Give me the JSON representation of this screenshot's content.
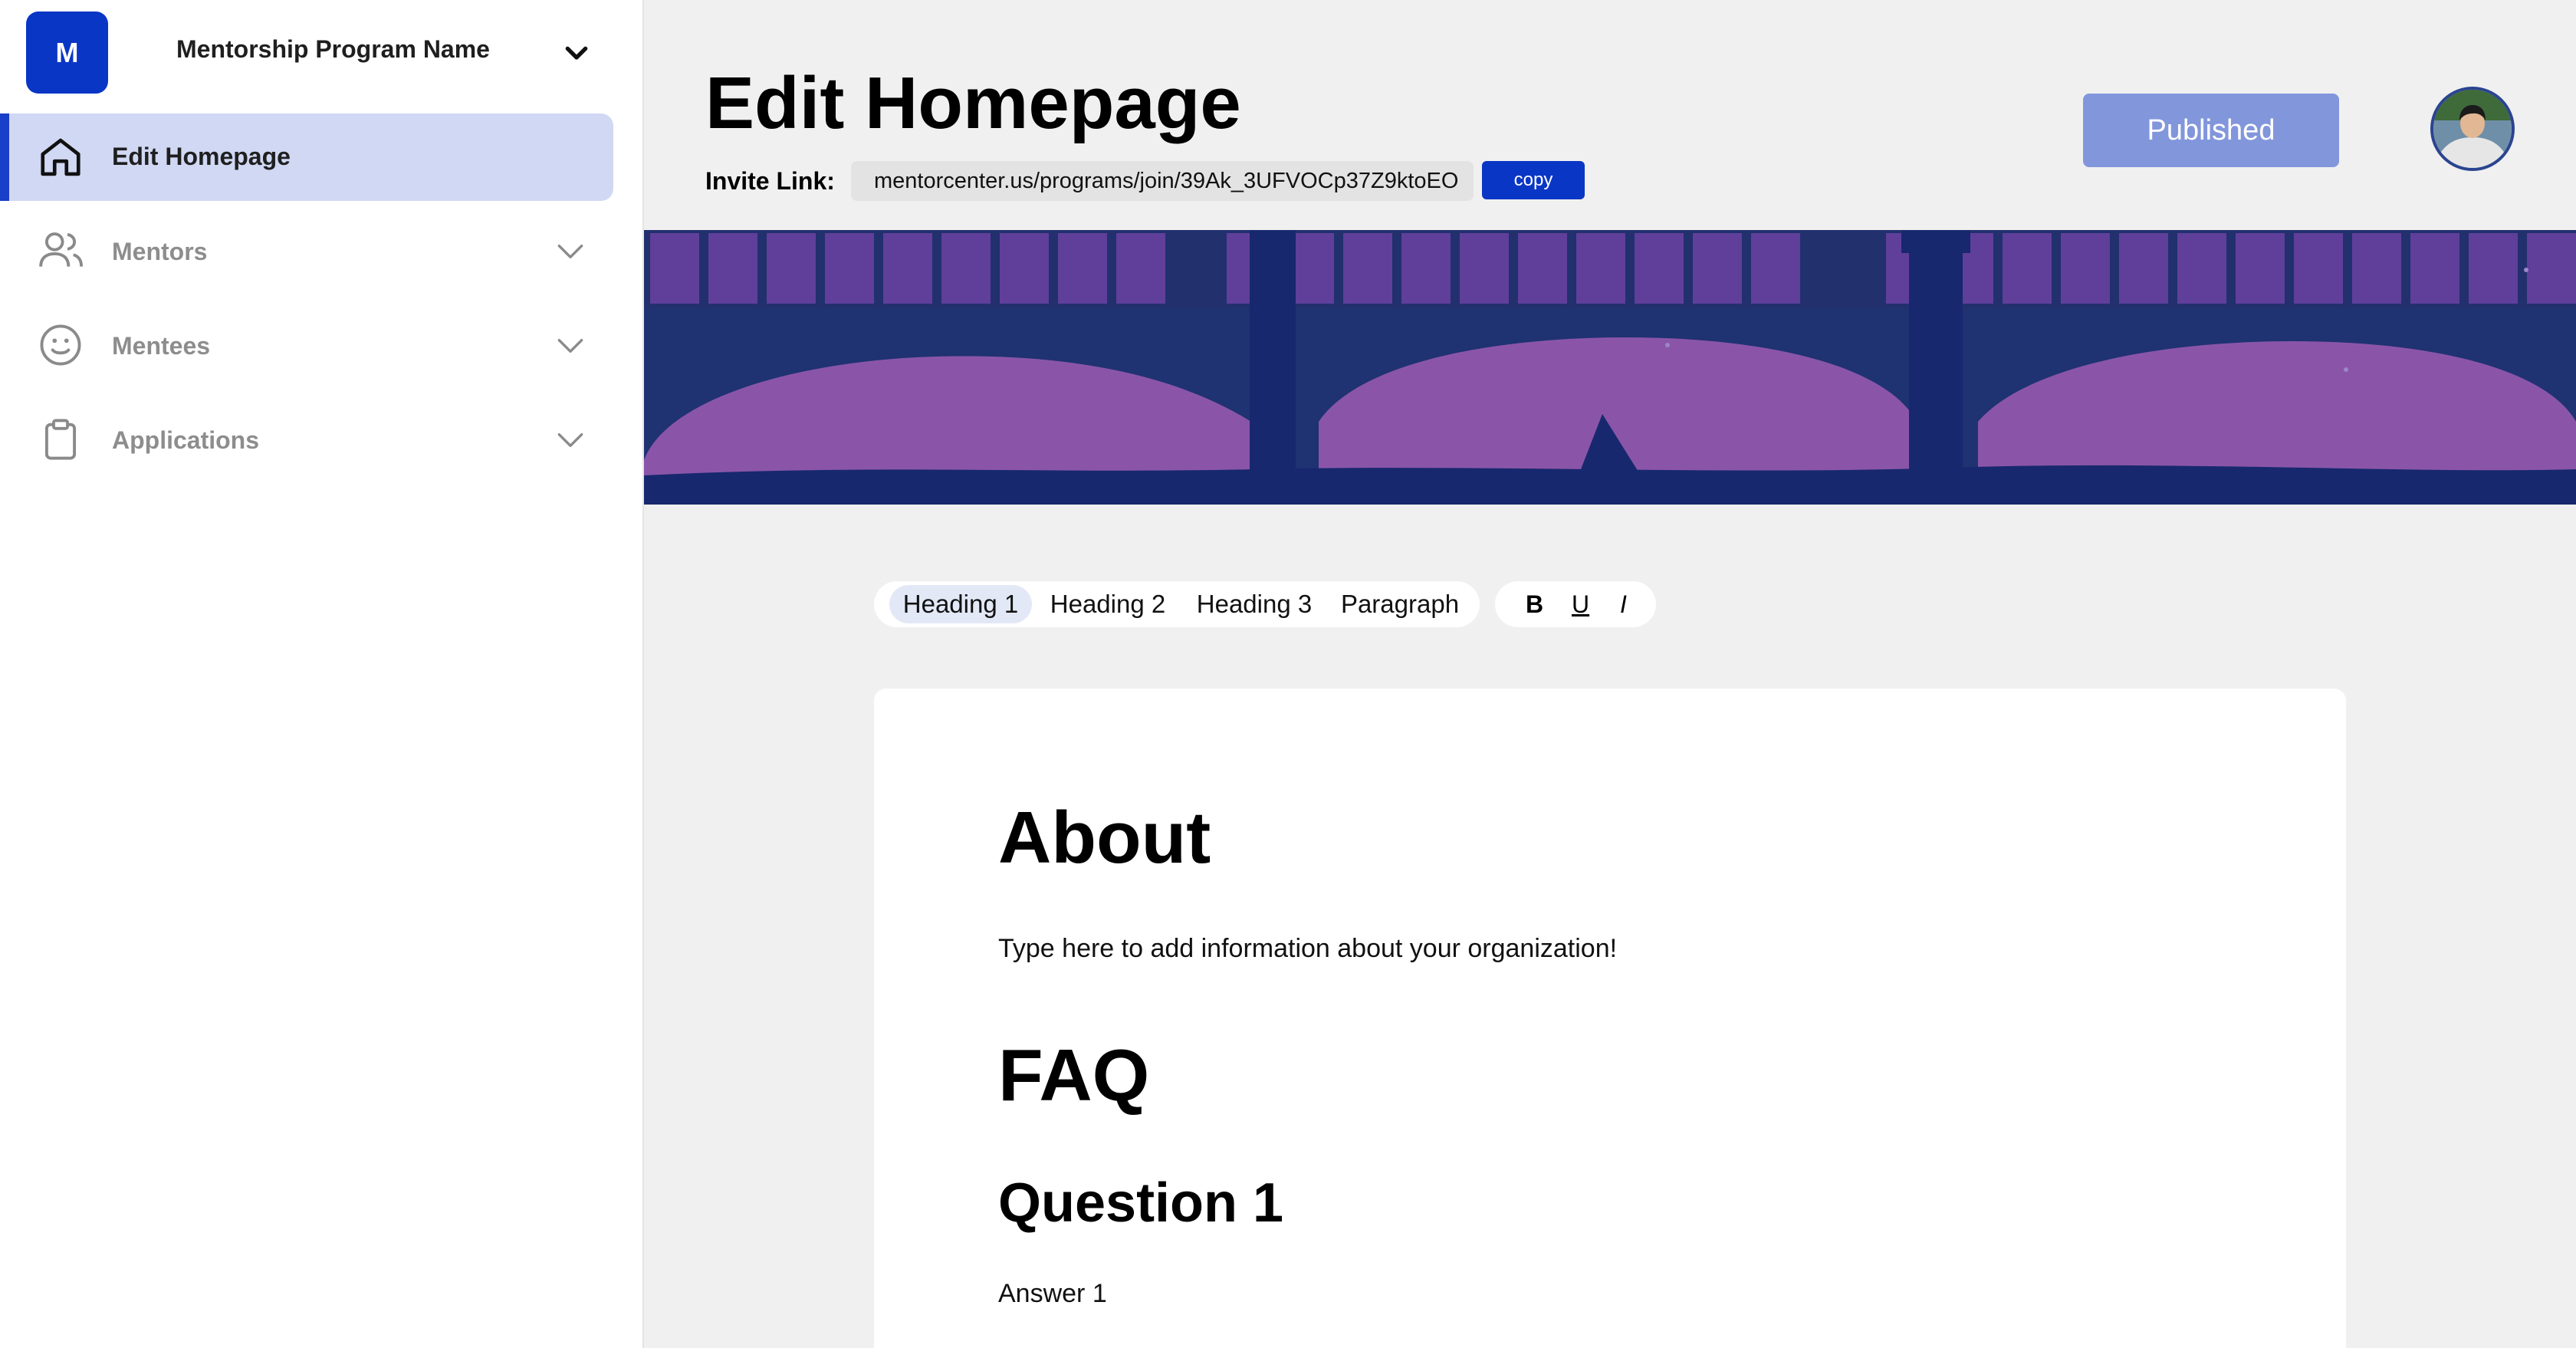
{
  "sidebar": {
    "program_initial": "M",
    "program_name": "Mentorship Program Name",
    "items": [
      {
        "label": "Edit Homepage",
        "icon": "home-icon",
        "active": true
      },
      {
        "label": "Mentors",
        "icon": "users-icon"
      },
      {
        "label": "Mentees",
        "icon": "smiley-icon"
      },
      {
        "label": "Applications",
        "icon": "clipboard-icon"
      }
    ]
  },
  "header": {
    "title": "Edit Homepage",
    "invite_label": "Invite Link:",
    "invite_url": "mentorcenter.us/programs/join/39Ak_3UFVOCp37Z9ktoEO",
    "copy_label": "copy",
    "published_label": "Published"
  },
  "toolbar": {
    "formats": [
      "Heading 1",
      "Heading 2",
      "Heading 3",
      "Paragraph"
    ],
    "active_format": "Heading 1",
    "styles": [
      "B",
      "U",
      "I"
    ]
  },
  "content": {
    "about_heading": "About",
    "about_text": "Type here to add information about your organization!",
    "faq_heading": "FAQ",
    "question_heading": "Question 1",
    "answer_text": "Answer 1"
  },
  "colors": {
    "accent": "#0a36c6",
    "active_nav_bg": "#d0d8f3",
    "published_bg": "#8296dc",
    "banner_sky": "#5c3d96",
    "banner_water": "#8a55a8",
    "banner_dark": "#17286e"
  }
}
